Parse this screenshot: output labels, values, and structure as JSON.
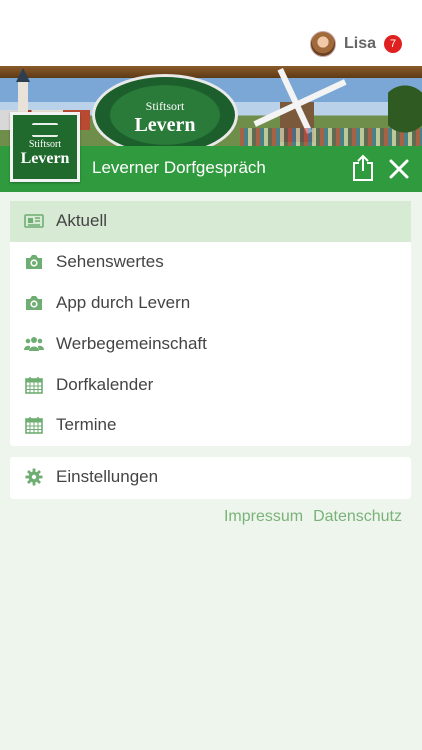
{
  "user": {
    "name": "Lisa",
    "notification_count": "7"
  },
  "banner": {
    "oval_line1": "Stiftsort",
    "oval_line2": "Levern"
  },
  "logo": {
    "line1": "Stiftsort",
    "line2": "Levern"
  },
  "header": {
    "title": "Leverner Dorfgespräch"
  },
  "menu": {
    "items": [
      {
        "label": "Aktuell",
        "icon": "newspaper-icon",
        "active": true
      },
      {
        "label": "Sehenswertes",
        "icon": "camera-icon"
      },
      {
        "label": "App durch Levern",
        "icon": "camera-icon"
      },
      {
        "label": "Werbegemeinschaft",
        "icon": "users-icon"
      },
      {
        "label": "Dorfkalender",
        "icon": "calendar-icon"
      },
      {
        "label": "Termine",
        "icon": "calendar-icon"
      }
    ]
  },
  "settings": {
    "label": "Einstellungen",
    "icon": "gear-icon"
  },
  "footer": {
    "impressum": "Impressum",
    "datenschutz": "Datenschutz"
  },
  "colors": {
    "header_green": "#2f9a3e",
    "icon_green": "#6fae73",
    "active_bg": "#d7ead4",
    "link_green": "#7ab27a",
    "badge_red": "#e0201f"
  }
}
